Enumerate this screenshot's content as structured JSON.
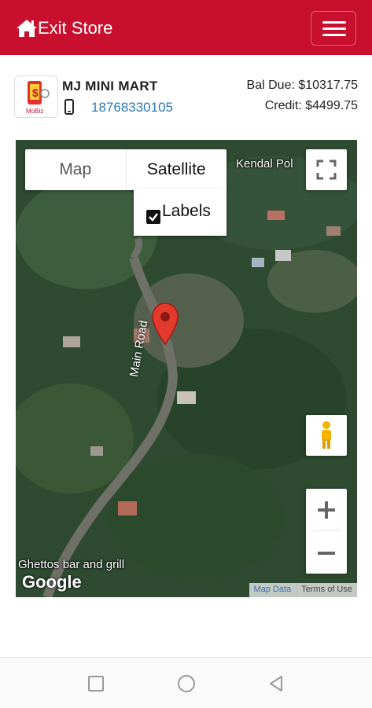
{
  "header": {
    "exit_label": "Exit Store",
    "color": "#c8102e"
  },
  "store": {
    "name": "MJ MINI MART",
    "phone": "18768330105",
    "balance_due": "Bal Due: $10317.75",
    "credit": "Credit: $4499.75",
    "logo_text": "MoBiz"
  },
  "map": {
    "type_options": [
      "Map",
      "Satellite"
    ],
    "selected_type": "Satellite",
    "labels_label": "Labels",
    "labels_checked": true,
    "places": {
      "kendal": "Kendal Pol",
      "ghettos": "Ghettos bar and grill",
      "road": "Main Road"
    },
    "google_logo": "Google",
    "map_data": "Map Data",
    "terms": "Terms of Use",
    "zoom_in": "+",
    "zoom_out": "−"
  },
  "icons": {
    "home": "home-icon",
    "menu": "hamburger-menu-icon",
    "phone": "mobile-phone-icon",
    "fullscreen": "fullscreen-icon",
    "pegman": "street-view-pegman-icon",
    "marker": "map-marker-icon"
  }
}
